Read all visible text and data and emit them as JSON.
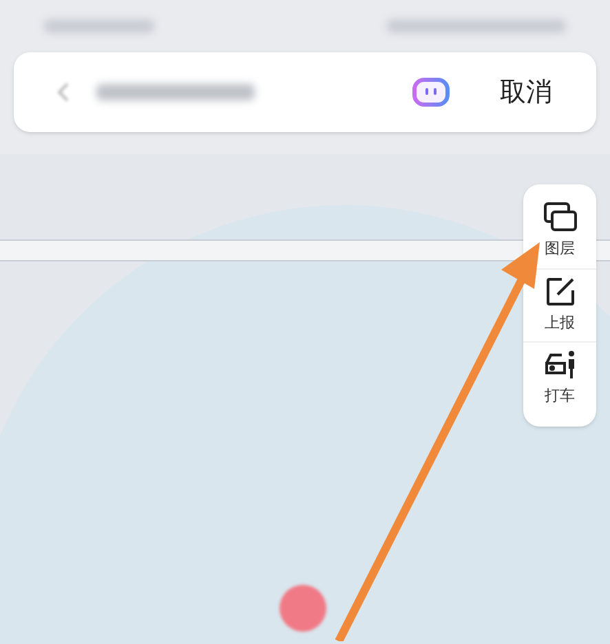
{
  "search_bar": {
    "cancel": "取消"
  },
  "map_tools": [
    {
      "kind": "layers",
      "label": "图层"
    },
    {
      "kind": "report",
      "label": "上报"
    },
    {
      "kind": "taxi",
      "label": "打车"
    }
  ]
}
